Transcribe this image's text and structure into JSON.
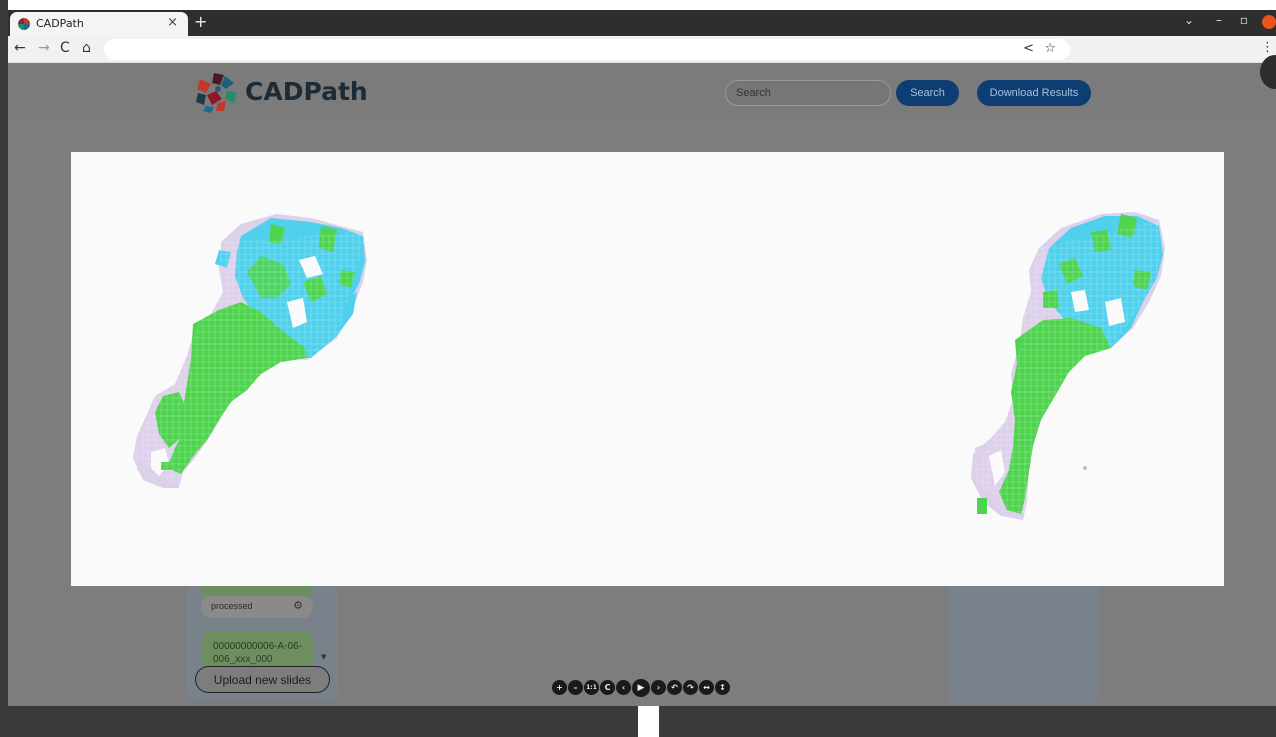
{
  "browser": {
    "tab_title": "CADPath",
    "tab_close": "×",
    "new_tab": "+",
    "nav": {
      "back": "←",
      "forward": "→",
      "reload": "C",
      "home": "⌂"
    },
    "share": "<",
    "bookmark": "☆",
    "menu": "⋮",
    "window_controls": {
      "dropdown": "⌄",
      "minimize": "–",
      "maximize": "▫"
    }
  },
  "header": {
    "app_name": "CADPath",
    "search_placeholder": "Search",
    "search_button": "Search",
    "download_button": "Download Results"
  },
  "sidebar": {
    "status": "processed",
    "slides": [
      {
        "name": "00000000006-A-06-006_xxx_000"
      }
    ],
    "upload_button": "Upload new slides"
  },
  "viewer_toolbar": [
    {
      "name": "zoom-in",
      "glyph": "+"
    },
    {
      "name": "zoom-out",
      "glyph": "–"
    },
    {
      "name": "actual-size",
      "glyph": "1:1"
    },
    {
      "name": "reset",
      "glyph": "C"
    },
    {
      "name": "prev",
      "glyph": "‹"
    },
    {
      "name": "play",
      "glyph": "▶"
    },
    {
      "name": "next",
      "glyph": "›"
    },
    {
      "name": "rotate-left",
      "glyph": "↶"
    },
    {
      "name": "rotate-right",
      "glyph": "↷"
    },
    {
      "name": "flip-horizontal",
      "glyph": "↔"
    },
    {
      "name": "flip-vertical",
      "glyph": "↕"
    }
  ],
  "colors": {
    "tumor_overlay": "#4fd0ec",
    "tissue_overlay": "#4ed44e",
    "background_tissue": "#dcd0ea",
    "primary_button": "#0d3d73"
  }
}
